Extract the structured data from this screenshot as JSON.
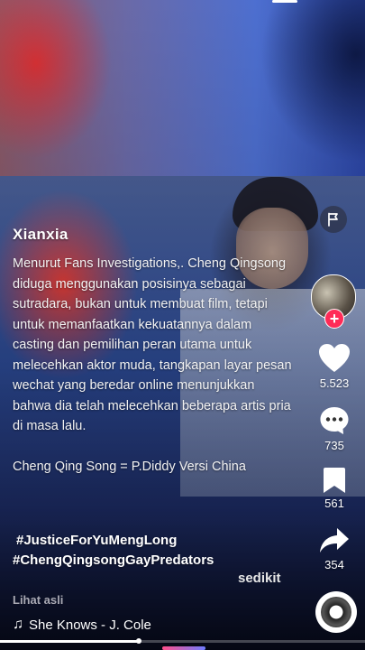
{
  "post": {
    "author": "Xianxia",
    "caption_lines": [
      "Menurut Fans Investigations,. Cheng Qingsong diduga menggunakan posisinya sebagai sutradara, bukan untuk membuat film, tetapi untuk memanfaatkan kekuatannya dalam casting dan pemilihan peran utama untuk melecehkan aktor muda, tangkapan layar pesan wechat yang beredar online menunjukkan bahwa dia telah melecehkan beberapa artis pria di masa lalu.",
      "Cheng Qing Song = P.Diddy Versi China"
    ],
    "hashtags": [
      "#JusticeForYuMengLong",
      "#ChengQingsongGayPredators"
    ],
    "more_label": "sedikit",
    "original_label": "Lihat asli",
    "music": "She Knows - J. Cole"
  },
  "actions": {
    "likes": "5.523",
    "comments": "735",
    "saves": "561",
    "shares": "354",
    "follow_symbol": "+"
  },
  "progress": {
    "fraction": 0.38
  },
  "colors": {
    "accent": "#ff2b57",
    "text": "#ffffff",
    "muted": "#a9a9b3"
  },
  "icons": [
    "menu-icon",
    "flag-icon",
    "heart-icon",
    "comment-icon",
    "bookmark-icon",
    "share-icon",
    "music-note-icon",
    "music-disc-icon"
  ]
}
